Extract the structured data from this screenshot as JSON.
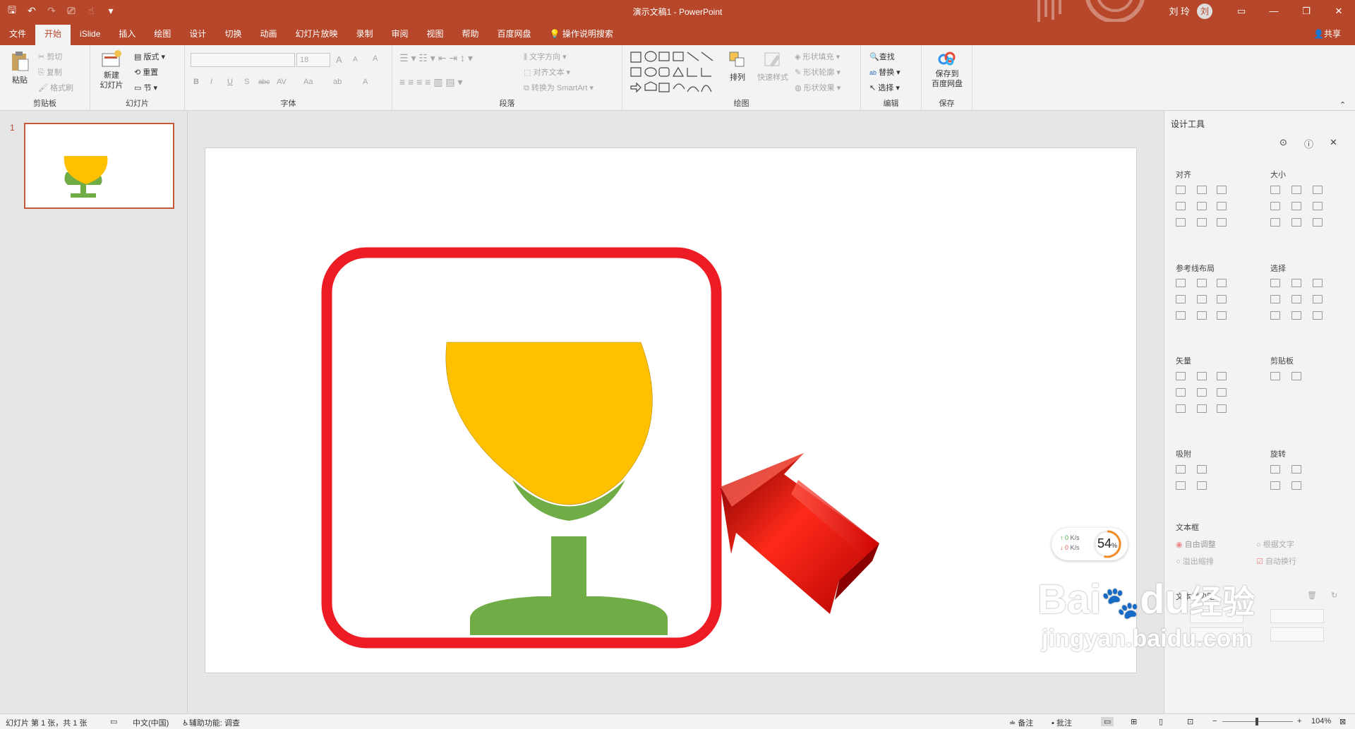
{
  "window": {
    "title": "演示文稿1 - PowerPoint",
    "user": "刘 玲",
    "avatar_initial": "刘"
  },
  "qat": {
    "save": "🖫",
    "undo": "↶",
    "redo": "↷",
    "present": "⎚",
    "touch": "☝",
    "more": "▾"
  },
  "tabs": [
    "文件",
    "开始",
    "iSlide",
    "插入",
    "绘图",
    "设计",
    "切换",
    "动画",
    "幻灯片放映",
    "录制",
    "审阅",
    "视图",
    "帮助",
    "百度网盘",
    "操作说明搜索"
  ],
  "share": "共享",
  "ribbon": {
    "clipboard": {
      "label": "剪贴板",
      "paste": "粘贴",
      "cut": "剪切",
      "copy": "复制",
      "format_painter": "格式刷"
    },
    "slides": {
      "label": "幻灯片",
      "new_slide_1": "新建",
      "new_slide_2": "幻灯片",
      "layout": "版式",
      "reset": "重置",
      "section": "节"
    },
    "font": {
      "label": "字体",
      "name": "",
      "size": "18",
      "bold": "B",
      "italic": "I",
      "underline": "U",
      "shadow": "S",
      "strike": "abc",
      "spacing": "AV",
      "case": "Aa",
      "highlight": "ab",
      "color": "A",
      "grow": "A",
      "shrink": "A",
      "clear": "A"
    },
    "paragraph": {
      "label": "段落",
      "text_direction": "文字方向",
      "align_text": "对齐文本",
      "smartart": "转换为 SmartArt"
    },
    "drawing": {
      "label": "绘图",
      "arrange": "排列",
      "quick_styles": "快速样式",
      "fill": "形状填充",
      "outline": "形状轮廓",
      "effects": "形状效果"
    },
    "editing": {
      "label": "编辑",
      "find": "查找",
      "replace": "替换",
      "select": "选择"
    },
    "save": {
      "label": "保存",
      "line1": "保存到",
      "line2": "百度网盘"
    }
  },
  "thumbnail": {
    "number": "1"
  },
  "design_pane": {
    "title": "设计工具",
    "sections": {
      "align": "对齐",
      "size": "大小",
      "guides": "参考线布局",
      "select": "选择",
      "vector": "矢量",
      "clipboard": "剪贴板",
      "snap": "吸附",
      "rotate": "旋转",
      "textbox": "文本框",
      "textbox_margin": "文本框边距"
    },
    "textbox_options": {
      "auto_fit": "自由调整",
      "fit_text": "根据文字",
      "overflow": "溢出缩排",
      "wrap": "自动换行"
    }
  },
  "net_widget": {
    "up": "0",
    "down": "0",
    "unit": "K/s",
    "percent": "54",
    "percent_sign": "%"
  },
  "statusbar": {
    "slide_info": "幻灯片 第 1 张，共 1 张",
    "language": "中文(中国)",
    "accessibility": "辅助功能: 调查",
    "notes": "备注",
    "comments": "批注",
    "zoom": "104%"
  },
  "watermark": {
    "brand": "Bai",
    "brand2": "du",
    "cn": "经验",
    "url": "jingyan.baidu.com"
  },
  "colors": {
    "accent": "#b7472a",
    "cup_bowl": "#ffc000",
    "cup_stem": "#70ad47",
    "frame": "#ed1c24",
    "arrow": "#e00000"
  }
}
